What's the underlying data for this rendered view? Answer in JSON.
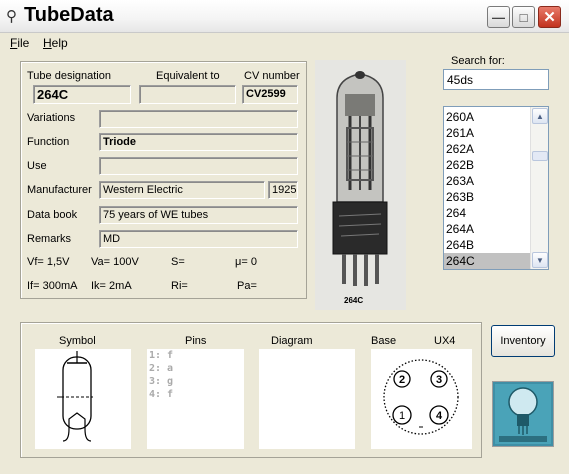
{
  "window": {
    "title": "TubeData"
  },
  "menu": {
    "file_mnemonic": "F",
    "file_rest": "ile",
    "help_mnemonic": "H",
    "help_rest": "elp"
  },
  "fields": {
    "tube_designation_label": "Tube designation",
    "tube_designation": "264C",
    "equivalent_label": "Equivalent to",
    "equivalent": "",
    "cv_label": "CV number",
    "cv": "CV2599",
    "variations_label": "Variations",
    "variations": "",
    "function_label": "Function",
    "function": "Triode",
    "use_label": "Use",
    "use": "",
    "manufacturer_label": "Manufacturer",
    "manufacturer": "Western Electric",
    "year": "1925",
    "databook_label": "Data book",
    "databook": "75 years of WE tubes",
    "remarks_label": "Remarks",
    "remarks": "MD"
  },
  "params": {
    "vf": "Vf= 1,5V",
    "va": "Va= 100V",
    "s": "S=",
    "mu": "μ=   0",
    "if": "If= 300mA",
    "ik": "Ik=  2mA",
    "ri": "Ri=",
    "pa": "Pa="
  },
  "photo_caption": "264C",
  "search": {
    "label": "Search for:",
    "value": "45ds"
  },
  "list": {
    "items": [
      "260A",
      "261A",
      "262A",
      "262B",
      "263A",
      "263B",
      "264",
      "264A",
      "264B",
      "264C"
    ],
    "selected": "264C"
  },
  "lower": {
    "symbol_label": "Symbol",
    "pins_label": "Pins",
    "diagram_label": "Diagram",
    "base_label": "Base",
    "base_type": "UX4",
    "pins": [
      "1: f",
      "2: a",
      "3: g",
      "4: f"
    ],
    "base_pins": [
      "1",
      "2",
      "3",
      "4"
    ]
  },
  "inventory_label": "Inventory",
  "colors": {
    "selection": "#c1c1c1",
    "field_bg": "#ece9d8",
    "window_bg": "#ece9d8"
  }
}
